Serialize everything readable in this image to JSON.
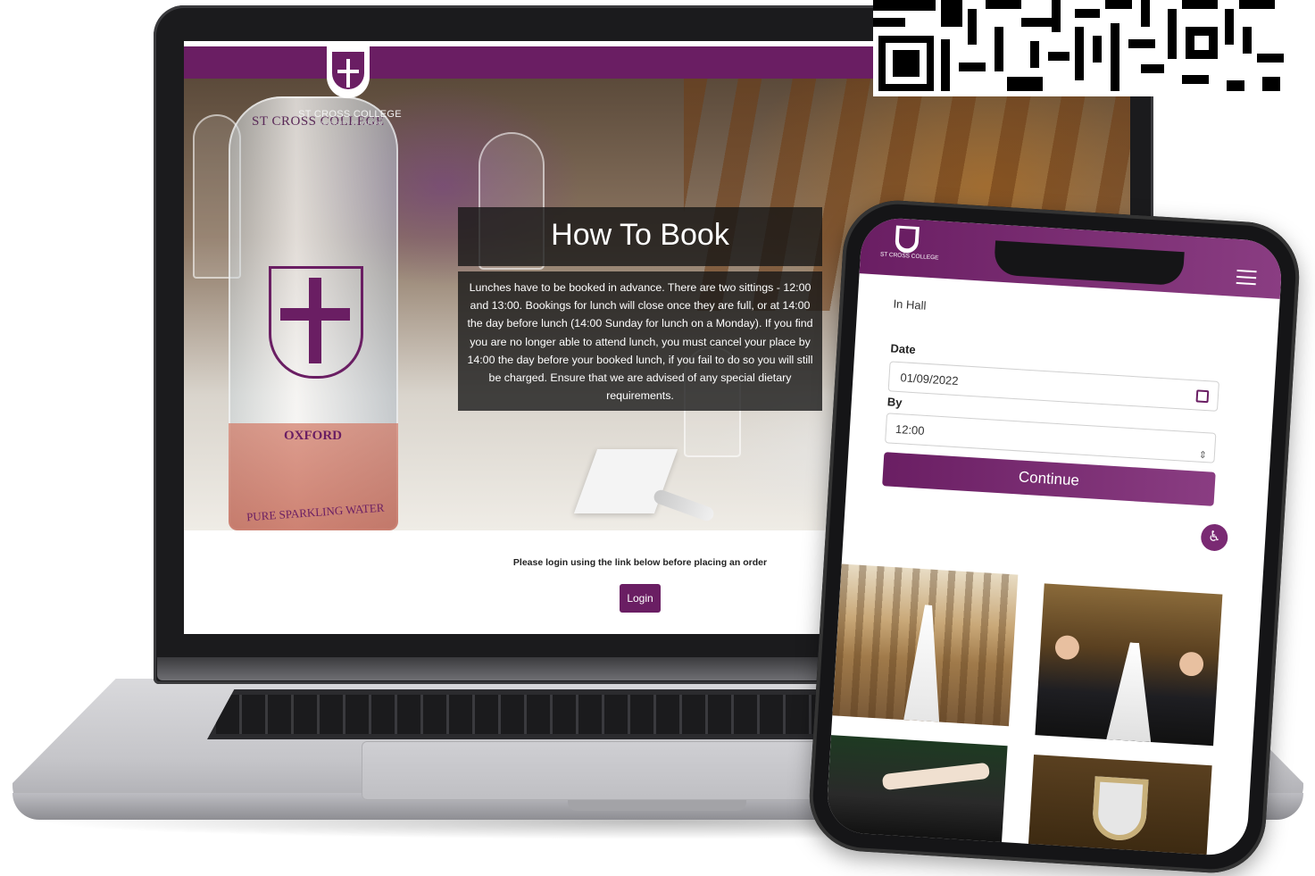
{
  "laptop": {
    "site": {
      "logo_text": "ST CROSS COLLEGE",
      "logo_subtext": "UNIVERSITY OF OXFORD",
      "howto_title": "How To Book",
      "howto_body": "Lunches have to be booked in advance. There are two sittings - 12:00 and 13:00. Bookings for lunch will close once they are full, or at 14:00 the day before lunch (14:00 Sunday for lunch on a Monday). If you find you are no longer able to attend lunch, you must cancel your place by 14:00 the day before your booked lunch, if you fail to do so you will still be charged. Ensure that we are advised of any special dietary requirements.",
      "login_message": "Please login using the link below before placing an order",
      "login_button": "Login"
    },
    "bottle": {
      "top_text": "ST CROSS COLLEGE",
      "mid_text": "OXFORD",
      "bottom_text": "PURE SPARKLING WATER"
    }
  },
  "phone": {
    "logo_text": "ST CROSS COLLEGE",
    "in_hall": "In Hall",
    "date_label": "Date",
    "date_value": "01/09/2022",
    "by_label": "By",
    "time_value": "12:00",
    "continue_button": "Continue",
    "accessibility_icon": "accessibility-icon",
    "menu_icon": "hamburger-menu-icon"
  },
  "colors": {
    "brand_purple": "#6a1e63"
  }
}
